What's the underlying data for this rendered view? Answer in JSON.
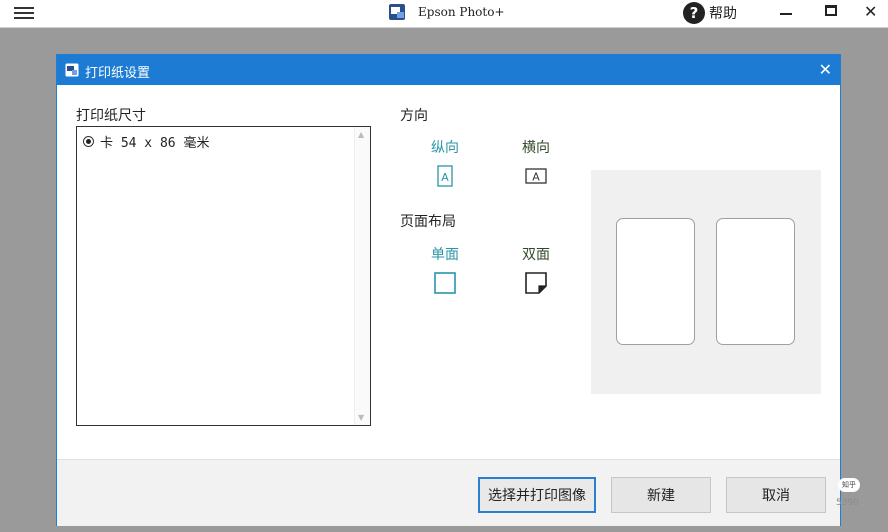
{
  "app": {
    "title": "Epson Photo+",
    "help_label": "帮助",
    "help_icon": "question-circle-icon",
    "menu_icon": "hamburger-icon"
  },
  "dialog": {
    "title": "打印纸设置",
    "paper_size": {
      "label": "打印纸尺寸",
      "items": [
        {
          "label": "卡 54 x 86 毫米",
          "selected": true
        }
      ]
    },
    "orientation": {
      "label": "方向",
      "options": [
        {
          "label": "纵向",
          "icon": "portrait-icon",
          "selected": true
        },
        {
          "label": "横向",
          "icon": "landscape-icon",
          "selected": false
        }
      ]
    },
    "layout": {
      "label": "页面布局",
      "options": [
        {
          "label": "单面",
          "icon": "single-sided-icon",
          "selected": true
        },
        {
          "label": "双面",
          "icon": "double-sided-icon",
          "selected": false
        }
      ]
    },
    "buttons": {
      "select_print": "选择并打印图像",
      "new": "新建",
      "cancel": "取消"
    }
  },
  "watermark": {
    "badge": "知乎",
    "text": "5390"
  },
  "colors": {
    "accent": "#1e7bd4",
    "selected_option": "#2896a8"
  }
}
